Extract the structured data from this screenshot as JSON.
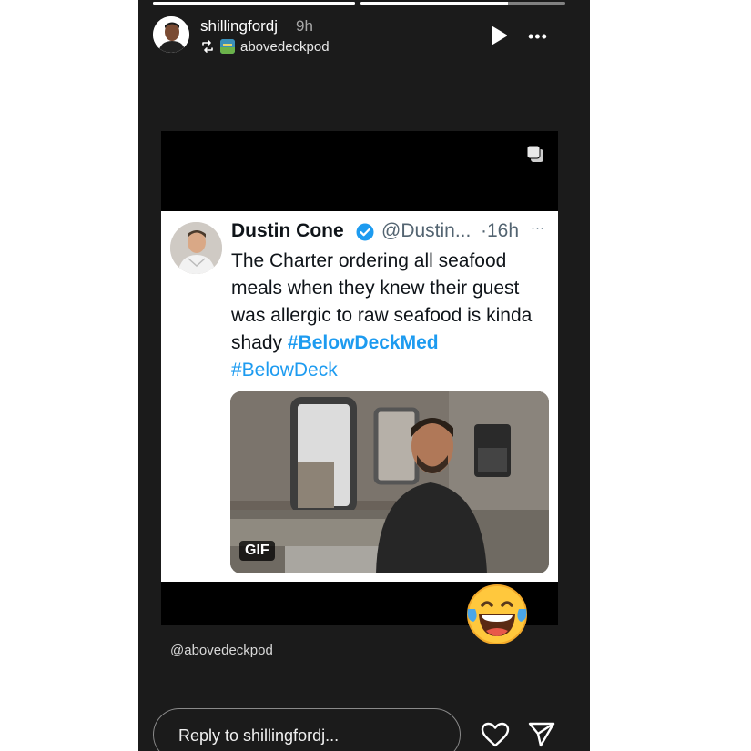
{
  "header": {
    "username": "shillingfordj",
    "time": "9h",
    "source_account": "abovedeckpod",
    "more_label": "•••",
    "progress": [
      1.0,
      0.72
    ]
  },
  "tweet": {
    "name": "Dustin Cone",
    "handle": "@Dustin...",
    "time": "·16h",
    "more": "···",
    "text": "The Charter ordering all seafood meals when they knew their guest was allergic to raw seafood is kinda shady",
    "hashtag1": "#BelowDeckMed",
    "hashtag2": "#BelowDeck",
    "gif_label": "GIF"
  },
  "sticker": {
    "emoji": "😂"
  },
  "mention": "@abovedeckpod",
  "reply": {
    "placeholder": "Reply to shillingfordj..."
  },
  "colors": {
    "background": "#1b1b1b",
    "link": "#1d9bf0",
    "verified": "#1d9bf0"
  },
  "icons": [
    "repost-icon",
    "play-icon",
    "more-icon",
    "copy-icon",
    "verified-icon",
    "heart-icon",
    "send-icon"
  ]
}
